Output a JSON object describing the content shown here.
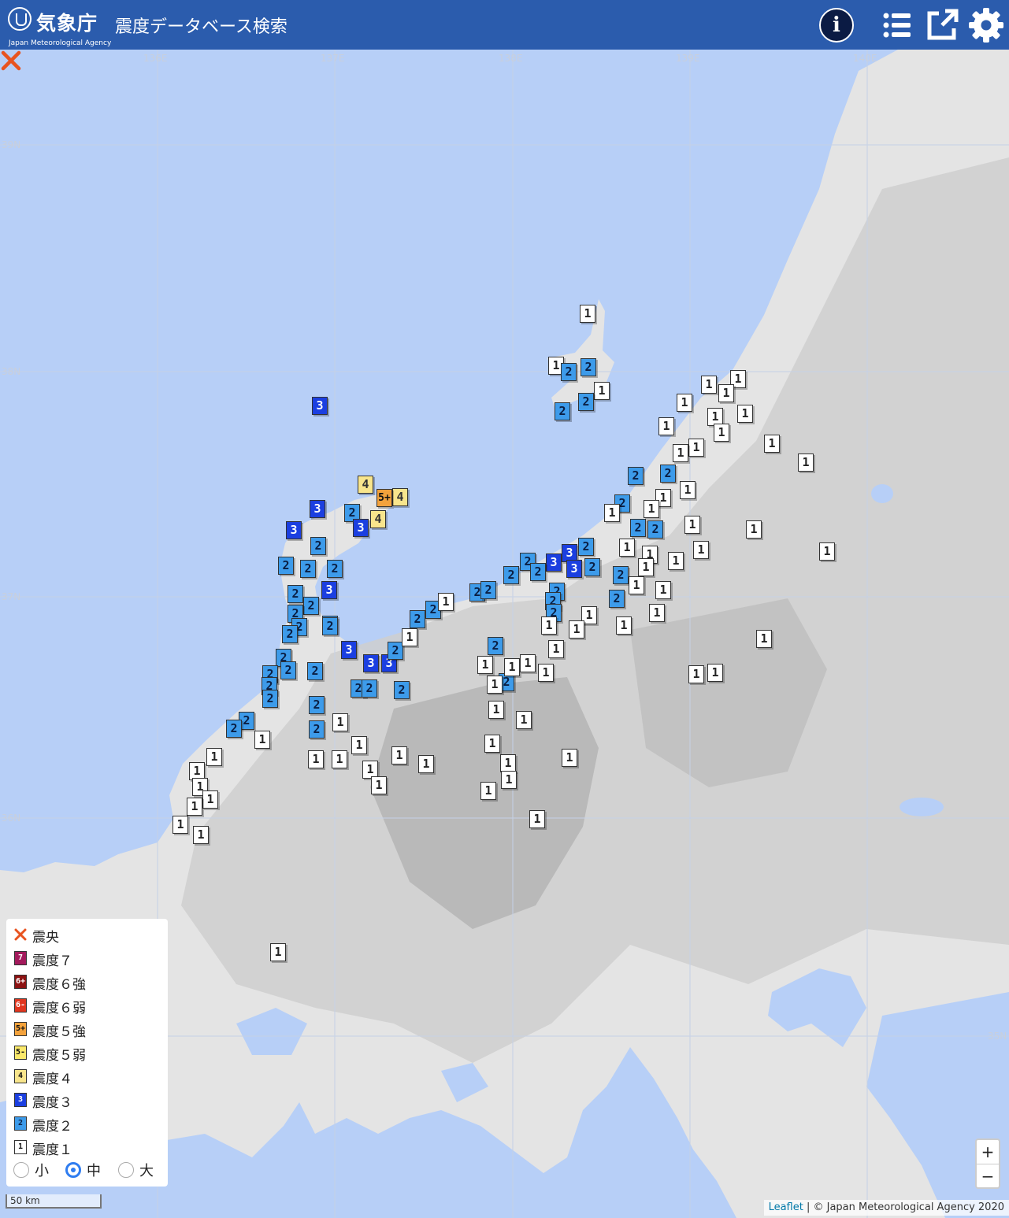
{
  "header": {
    "org_name": "気象庁",
    "org_name_en": "Japan Meteorological Agency",
    "app_title": "震度データベース検索"
  },
  "icons": [
    "info-icon",
    "list-icon",
    "external-link-icon",
    "gear-icon"
  ],
  "grid": {
    "lon_labels": [
      "136E",
      "137E",
      "138E",
      "139E",
      "140E"
    ],
    "lat_labels": [
      "39N",
      "38N",
      "37N",
      "36N",
      "35N"
    ]
  },
  "intensity_colors": {
    "7": "#a31a5c",
    "6+": "#8c1212",
    "6-": "#e0361f",
    "5+": "#f3a23c",
    "5-": "#f8e58c",
    "4": "#f8e58c",
    "3": "#1b3fe0",
    "2": "#3d9bea",
    "1": "#ffffff"
  },
  "epicenter_symbol": "×",
  "legend": {
    "items": [
      {
        "symbol": "×",
        "label": "震央"
      },
      {
        "symbol": "7",
        "label": "震度７"
      },
      {
        "symbol": "6+",
        "label": "震度６強"
      },
      {
        "symbol": "6-",
        "label": "震度６弱"
      },
      {
        "symbol": "5+",
        "label": "震度５強"
      },
      {
        "symbol": "5-",
        "label": "震度５弱"
      },
      {
        "symbol": "4",
        "label": "震度４"
      },
      {
        "symbol": "3",
        "label": "震度３"
      },
      {
        "symbol": "2",
        "label": "震度２"
      },
      {
        "symbol": "1",
        "label": "震度１"
      }
    ],
    "sizes": {
      "small": "小",
      "medium": "中",
      "large": "大",
      "selected": "中"
    }
  },
  "zoom": {
    "in": "+",
    "out": "−"
  },
  "scale_label": "50 km",
  "attribution": {
    "link": "Leaflet",
    "text": " | © Japan Meteorological Agency 2020"
  }
}
